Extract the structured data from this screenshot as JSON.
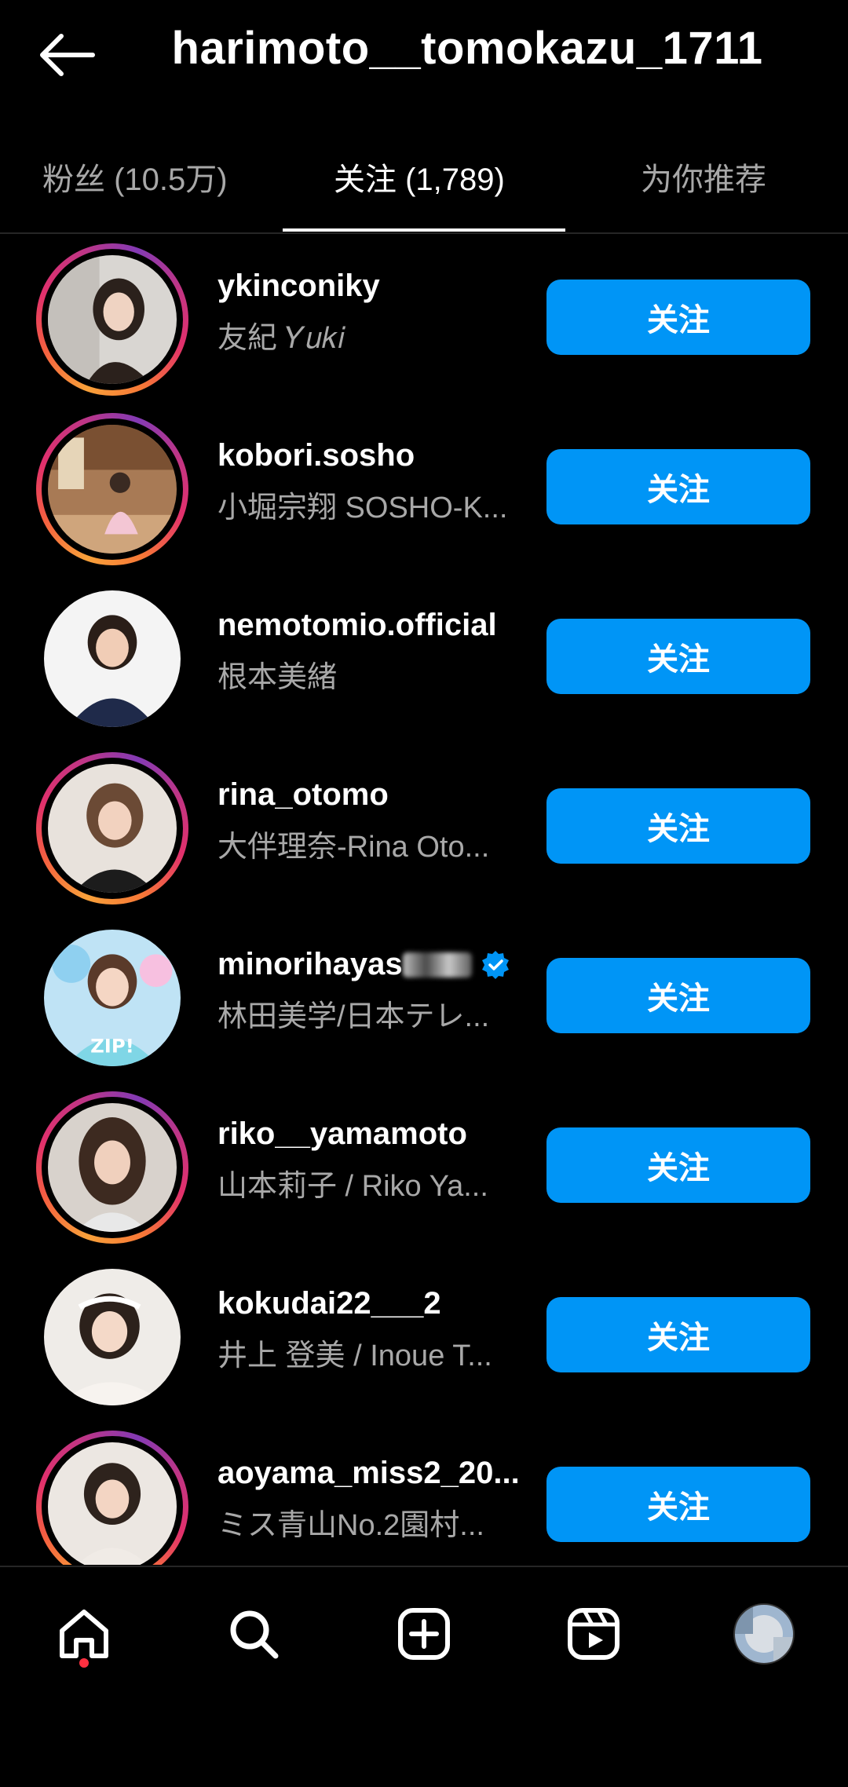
{
  "header": {
    "title": "harimoto__tomokazu_1711",
    "back_icon": "back-arrow-icon"
  },
  "tabs": [
    {
      "label": "粉丝 (10.5万)",
      "active": false
    },
    {
      "label": "关注 (1,789)",
      "active": true
    },
    {
      "label": "为你推荐",
      "active": false
    }
  ],
  "following": [
    {
      "username": "ykinconiky",
      "full_name": "友紀  𝑌𝑢𝑘𝑖",
      "button": "关注",
      "story_ring": true,
      "verified": false
    },
    {
      "username": "kobori.sosho",
      "full_name": "小堀宗翔 SOSHO-K...",
      "button": "关注",
      "story_ring": true,
      "verified": false
    },
    {
      "username": "nemotomio.official",
      "full_name": "根本美緒",
      "button": "关注",
      "story_ring": false,
      "verified": false
    },
    {
      "username": "rina_otomo",
      "full_name": "大伴理奈-Rina Oto...",
      "button": "关注",
      "story_ring": true,
      "verified": false
    },
    {
      "username": "minorihayas",
      "full_name": "林田美学/日本テレ...",
      "button": "关注",
      "story_ring": false,
      "verified": true
    },
    {
      "username": "riko__yamamoto",
      "full_name": "山本莉子 / Riko Ya...",
      "button": "关注",
      "story_ring": true,
      "verified": false
    },
    {
      "username": "kokudai22___2",
      "full_name": "井上 登美 / Inoue T...",
      "button": "关注",
      "story_ring": false,
      "verified": false
    },
    {
      "username": "aoyama_miss2_20...",
      "full_name": "ミス青山No.2園村...",
      "button": "关注",
      "story_ring": true,
      "verified": false
    }
  ],
  "bottom_nav": [
    {
      "icon": "home-icon",
      "active": true,
      "notification_dot": true
    },
    {
      "icon": "search-icon",
      "active": false
    },
    {
      "icon": "create-post-icon",
      "active": false
    },
    {
      "icon": "reels-icon",
      "active": false
    },
    {
      "icon": "profile-avatar-icon",
      "active": false
    }
  ],
  "colors": {
    "background": "#000000",
    "primary_button": "#0095f6",
    "secondary_text": "#a8a8a8",
    "notification_dot": "#ff3040"
  }
}
